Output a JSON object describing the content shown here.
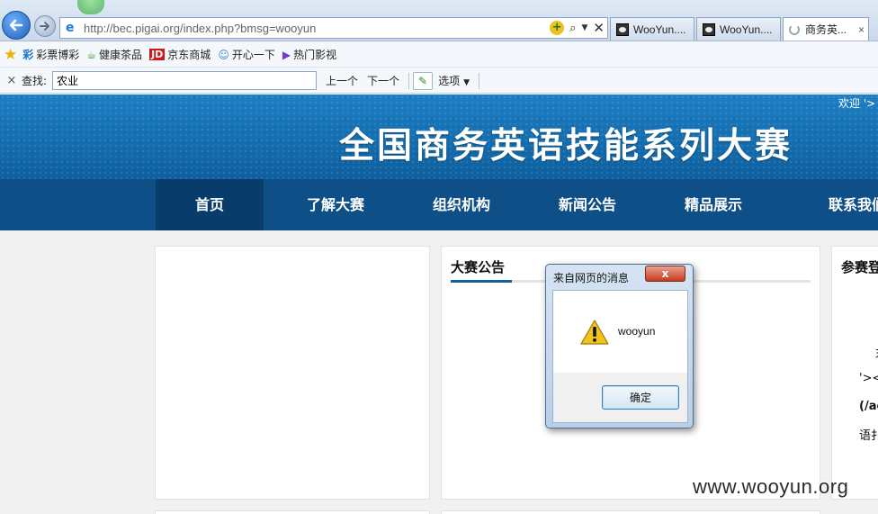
{
  "browser": {
    "address_url": "http://bec.pigai.org/index.php?bmsg=wooyun",
    "tabs": [
      {
        "label": "WooYun...."
      },
      {
        "label": "WooYun...."
      },
      {
        "label": "商务英..."
      }
    ],
    "tab_close": "×",
    "favorites": [
      {
        "icon_text": "彩",
        "label": "彩票博彩",
        "color": "#1a6fc9"
      },
      {
        "icon_text": "☕",
        "label": "健康茶品",
        "color": "#4a9a2a"
      },
      {
        "icon_text": "JD",
        "label": "京东商城",
        "color": "#d01818"
      },
      {
        "icon_text": "☺",
        "label": "开心一下",
        "color": "#3a8ad0"
      },
      {
        "icon_text": "▶",
        "label": "热门影视",
        "color": "#7a3ac8"
      }
    ],
    "find": {
      "close": "×",
      "label": "查找:",
      "value": "农业",
      "prev": "上一个",
      "next": "下一个",
      "options": "选项"
    }
  },
  "site": {
    "welcome": "欢迎 '> <",
    "title": "全国商务英语技能系列大赛",
    "nav": [
      "首页",
      "了解大赛",
      "组织机构",
      "新闻公告",
      "精品展示",
      "联系我们"
    ],
    "panel_mid_title": "大赛公告",
    "panel_right_title": "参赛登",
    "right_fragments": [
      "末",
      "'><",
      "(/ac",
      "语扌"
    ]
  },
  "dialog": {
    "title": "来自网页的消息",
    "close": "x",
    "message": "wooyun",
    "ok": "确定"
  },
  "watermark": "www.wooyun.org"
}
